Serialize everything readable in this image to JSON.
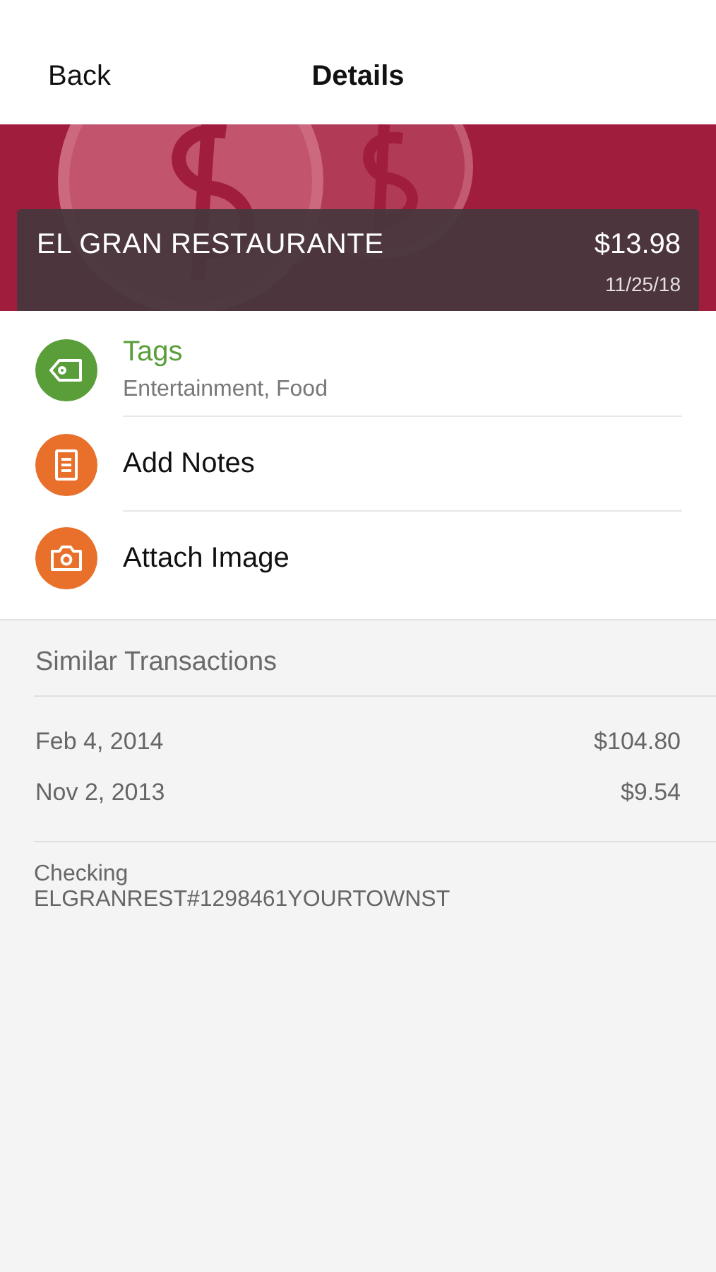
{
  "nav": {
    "back": "Back",
    "title": "Details"
  },
  "transaction": {
    "merchant": "EL GRAN RESTAURANTE",
    "amount": "$13.98",
    "date": "11/25/18"
  },
  "actions": [
    {
      "kind": "tag",
      "color": "#5a9e3a",
      "label": "Tags",
      "detail": "Entertainment, Food"
    },
    {
      "kind": "notes",
      "color": "#e8702a",
      "label": "Add Notes"
    },
    {
      "kind": "camera",
      "color": "#e8702a",
      "label": "Attach Image"
    }
  ],
  "similar": {
    "title": "Similar Transactions",
    "rows": [
      {
        "date": "Feb 4, 2014",
        "amount": "$104.80"
      },
      {
        "date": "Nov 2, 2013",
        "amount": "$9.54"
      }
    ]
  },
  "account": {
    "name": "Checking",
    "description": "ELGRANREST#1298461YOURTOWNST"
  }
}
